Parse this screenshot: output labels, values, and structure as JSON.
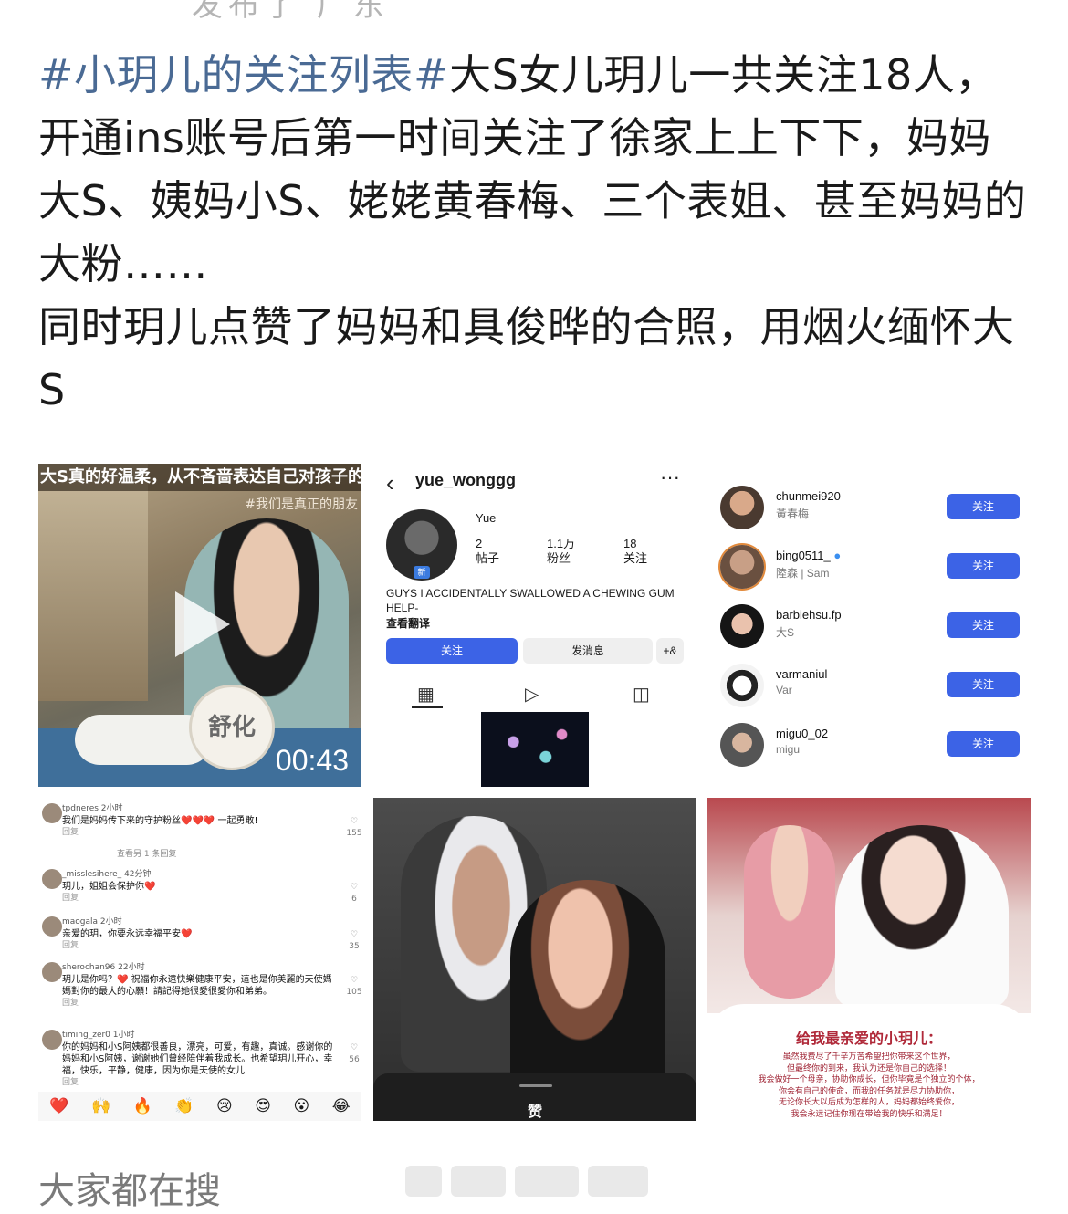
{
  "top_cutoff_text": "发布了 广东",
  "post": {
    "hashtag": "#小玥儿的关注列表#",
    "line1": "大S女儿玥儿一共关注18人，开通ins账号后第一时间关注了徐家上上下下，妈妈大S、姨妈小S、姥姥黄春梅、三个表姐、甚至妈妈的大粉……",
    "line2": "同时玥儿点赞了妈妈和具俊晔的合照，用烟火缅怀大S"
  },
  "tile_video": {
    "banner": "大S真的好温柔，从不吝啬表达自己对孩子的爱",
    "subtitle": "#我们是真正的朋友",
    "sign_text": "舒化",
    "duration": "00:43"
  },
  "tile_profile": {
    "back_icon": "chevron-left-icon",
    "username": "yue_wonggg",
    "more": "···",
    "new_badge": "新",
    "display_name": "Yue",
    "stats": [
      {
        "value": "2",
        "label": "帖子"
      },
      {
        "value": "1.1万",
        "label": "粉丝"
      },
      {
        "value": "18",
        "label": "关注"
      }
    ],
    "bio": "GUYS I ACCIDENTALLY SWALLOWED A CHEWING GUM HELP-",
    "translate": "查看翻译",
    "follow_btn": "关注",
    "message_btn": "发消息",
    "add_btn": "+&",
    "accent": "#3c63e6"
  },
  "tile_following": {
    "rows": [
      {
        "name": "chunmei920",
        "sub": "黃春梅",
        "btn": "关注"
      },
      {
        "name": "bing0511_",
        "sub": "陸森 | Sam",
        "btn": "关注"
      },
      {
        "name": "barbiehsu.fp",
        "sub": "大S",
        "btn": "关注"
      },
      {
        "name": "varmaniul",
        "sub": "Var",
        "btn": "关注"
      },
      {
        "name": "migu0_02",
        "sub": "migu",
        "btn": "关注"
      }
    ]
  },
  "tile_comments": {
    "more_replies": "查看另 1 条回复",
    "comments": [
      {
        "user": "tpdneres 2小时",
        "text": "我们是妈妈传下来的守护粉丝❤️❤️❤️ 一起勇敢!",
        "reply": "回复",
        "likes": "155"
      },
      {
        "user": "_misslesihere_ 42分钟",
        "text": "玥儿，姐姐会保护你❤️",
        "reply": "回复",
        "likes": "6"
      },
      {
        "user": "maogala 2小时",
        "text": "亲爱的玥，你要永远幸福平安❤️",
        "reply": "回复",
        "likes": "35"
      },
      {
        "user": "sherochan96 22小时",
        "text": "玥儿是你吗？❤️ 祝福你永遠快樂健康平安，這也是你美麗的天使媽媽對你的最大的心願！請記得她很愛很愛你和弟弟。",
        "reply": "回复",
        "likes": "105"
      },
      {
        "user": "timing_zer0 1小时",
        "text": "你的妈妈和小S阿姨都很善良，漂亮，可爱，有趣，真诚。感谢你的妈妈和小S阿姨，谢谢她们曾经陪伴着我成长。也希望玥儿开心，幸福，快乐，平静，健康，因为你是天使的女儿",
        "reply": "回复",
        "likes": "56"
      }
    ],
    "emojis": [
      "❤️",
      "🙌",
      "🔥",
      "👏",
      "😢",
      "😍",
      "😮",
      "😂"
    ]
  },
  "tile_photo": {
    "like_label": "赞"
  },
  "tile_letter": {
    "title": "给我最亲爱的小玥儿：",
    "lines": [
      "虽然我费尽了千辛万苦希望把你带来这个世界，",
      "但最终你的到来，我认为还是你自己的选择！",
      "我会做好一个母亲，协助你成长，但你毕竟是个独立的个体，",
      "你会有自己的使命，而我的任务就是尽力协助你，",
      "无论你长大以后成为怎样的人，妈妈都始终爱你，",
      "我会永远记住你现在带给我的快乐和满足！"
    ]
  },
  "search_label": "大家都在搜"
}
